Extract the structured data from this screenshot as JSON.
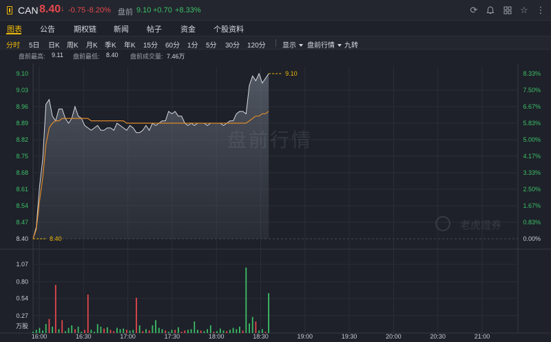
{
  "header": {
    "symbol": "CAN",
    "price": "8.40",
    "price_arrow": "↓",
    "change": "-0.75",
    "change_pct": "-8.20%",
    "premarket_label": "盘前",
    "premarket_price": "9.10",
    "premarket_change": "+0.70",
    "premarket_change_pct": "+8.33%",
    "icons": [
      "refresh-icon",
      "bell-icon",
      "grid-icon",
      "star-icon"
    ]
  },
  "tabs": [
    {
      "label": "图表",
      "active": true
    },
    {
      "label": "公告"
    },
    {
      "label": "期权链"
    },
    {
      "label": "新闻"
    },
    {
      "label": "帖子"
    },
    {
      "label": "资金"
    },
    {
      "label": "个股资料"
    }
  ],
  "periods": [
    {
      "label": "分时",
      "active": true
    },
    {
      "label": "5日"
    },
    {
      "label": "日K"
    },
    {
      "label": "周K"
    },
    {
      "label": "月K"
    },
    {
      "label": "季K"
    },
    {
      "label": "年K"
    },
    {
      "label": "15分"
    },
    {
      "label": "60分"
    },
    {
      "label": "1分"
    },
    {
      "label": "5分"
    },
    {
      "label": "30分"
    },
    {
      "label": "120分"
    }
  ],
  "options": {
    "display": "显示",
    "premarket": "盘前行情",
    "nine": "九转"
  },
  "stats": {
    "high_label": "盘前最高:",
    "high_value": "9.11",
    "low_label": "盘前最低:",
    "low_value": "8.40",
    "volume_label": "盘前成交量:",
    "volume_value": "7.46万"
  },
  "watermark": "盘前行情",
  "brand": "老虎證券",
  "colors": {
    "up": "#3cc068",
    "down": "#e5484d",
    "accent": "#f0b90b",
    "avg_line": "#e08a2c",
    "price_line": "#d8dce2"
  },
  "chart_data": {
    "type": "line",
    "price_ticks": [
      "9.10",
      "9.03",
      "8.96",
      "8.89",
      "8.82",
      "8.75",
      "8.68",
      "8.61",
      "8.54",
      "8.47",
      "8.40"
    ],
    "pct_ticks": [
      "8.33%",
      "7.50%",
      "6.67%",
      "5.83%",
      "5.00%",
      "4.17%",
      "3.33%",
      "2.50%",
      "1.67%",
      "0.83%",
      "0.00%"
    ],
    "volume_ticks": [
      "1.07",
      "0.80",
      "0.54",
      "0.27"
    ],
    "volume_unit": "万股",
    "time_ticks": [
      "16:00",
      "16:30",
      "17:00",
      "17:30",
      "18:00",
      "18:30",
      "19:00",
      "19:30",
      "20:00",
      "20:30",
      "21:00"
    ],
    "ylim": [
      8.4,
      9.1
    ],
    "base_price": 8.4,
    "high_marker": "9.10",
    "low_marker": "8.40",
    "price": [
      8.4,
      8.45,
      8.62,
      8.74,
      8.97,
      8.99,
      8.92,
      8.9,
      8.95,
      8.95,
      8.91,
      8.89,
      8.91,
      8.96,
      8.92,
      8.91,
      8.88,
      8.87,
      8.86,
      8.87,
      8.88,
      8.86,
      8.86,
      8.87,
      8.87,
      8.86,
      8.89,
      8.88,
      8.87,
      8.86,
      8.88,
      8.87,
      8.85,
      8.85,
      8.86,
      8.88,
      8.86,
      8.89,
      8.88,
      8.89,
      8.9,
      8.9,
      8.94,
      8.93,
      8.94,
      8.92,
      8.92,
      8.89,
      8.88,
      8.89,
      8.88,
      8.89,
      8.89,
      8.89,
      8.88,
      8.89,
      8.89,
      8.89,
      8.89,
      8.88,
      8.89,
      8.9,
      8.9,
      8.93,
      8.94,
      8.94,
      8.93,
      9.05,
      9.09,
      9.07,
      9.1,
      9.06,
      9.08,
      9.1
    ],
    "avg": [
      8.4,
      8.44,
      8.56,
      8.66,
      8.8,
      8.87,
      8.89,
      8.9,
      8.9,
      8.91,
      8.91,
      8.91,
      8.91,
      8.91,
      8.91,
      8.91,
      8.91,
      8.91,
      8.9,
      8.9,
      8.9,
      8.9,
      8.9,
      8.9,
      8.9,
      8.9,
      8.9,
      8.9,
      8.9,
      8.89,
      8.89,
      8.89,
      8.89,
      8.89,
      8.89,
      8.89,
      8.89,
      8.89,
      8.89,
      8.89,
      8.89,
      8.89,
      8.89,
      8.89,
      8.89,
      8.89,
      8.89,
      8.89,
      8.89,
      8.89,
      8.89,
      8.89,
      8.89,
      8.89,
      8.89,
      8.89,
      8.89,
      8.89,
      8.89,
      8.89,
      8.89,
      8.89,
      8.89,
      8.89,
      8.89,
      8.89,
      8.89,
      8.9,
      8.91,
      8.92,
      8.92,
      8.93,
      8.93,
      8.94
    ],
    "volume": [
      0.02,
      0.05,
      0.08,
      0.04,
      0.14,
      0.22,
      0.1,
      0.75,
      0.06,
      0.2,
      0.03,
      0.08,
      0.12,
      0.06,
      0.1,
      0.02,
      0.05,
      0.6,
      0.05,
      0.02,
      0.14,
      0.1,
      0.07,
      0.09,
      0.05,
      0.03,
      0.08,
      0.06,
      0.07,
      0.05,
      0.04,
      0.05,
      0.55,
      0.12,
      0.03,
      0.06,
      0.04,
      0.12,
      0.2,
      0.08,
      0.06,
      0.04,
      0.02,
      0.05,
      0.05,
      0.09,
      0.02,
      0.04,
      0.05,
      0.06,
      0.18,
      0.05,
      0.04,
      0.03,
      0.06,
      0.12,
      0.02,
      0.03,
      0.07,
      0.04,
      0.03,
      0.05,
      0.08,
      0.06,
      0.1,
      0.04,
      1.02,
      0.15,
      0.25,
      0.18,
      0.04,
      0.06,
      0.02,
      0.62
    ],
    "volume_up": [
      true,
      true,
      true,
      true,
      true,
      false,
      true,
      false,
      true,
      false,
      true,
      true,
      true,
      false,
      true,
      true,
      false,
      false,
      true,
      true,
      true,
      true,
      false,
      true,
      false,
      false,
      true,
      true,
      true,
      false,
      true,
      true,
      false,
      true,
      false,
      true,
      false,
      true,
      true,
      true,
      true,
      false,
      true,
      true,
      false,
      true,
      false,
      false,
      true,
      true,
      true,
      true,
      false,
      true,
      true,
      true,
      false,
      true,
      true,
      true,
      false,
      true,
      true,
      true,
      true,
      false,
      true,
      true,
      true,
      false,
      true,
      true,
      false,
      true
    ]
  }
}
